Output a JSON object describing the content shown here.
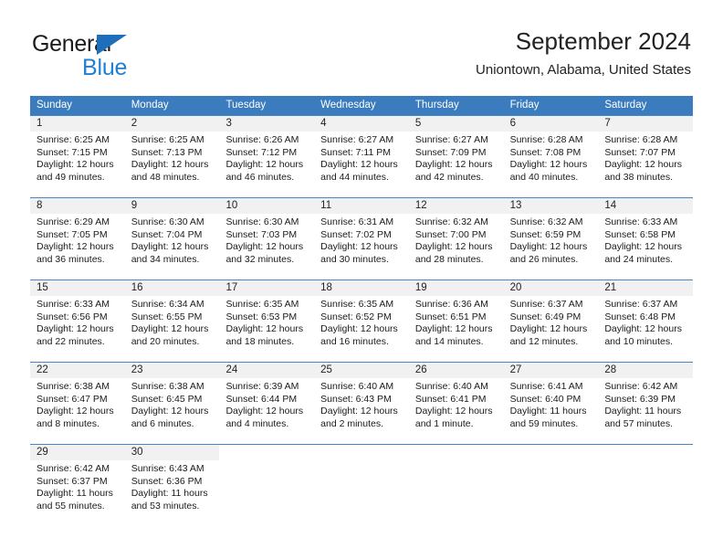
{
  "brand": {
    "word1": "General",
    "word2": "Blue",
    "triangle_color": "#1e6fba",
    "word2_color": "#1e7fd4"
  },
  "header": {
    "title": "September 2024",
    "subtitle": "Uniontown, Alabama, United States"
  },
  "calendar": {
    "header_bg": "#3a7cbe",
    "daynum_bg": "#f1f1f1",
    "weekdays": [
      "Sunday",
      "Monday",
      "Tuesday",
      "Wednesday",
      "Thursday",
      "Friday",
      "Saturday"
    ],
    "weeks": [
      [
        {
          "day": "1",
          "l1": "Sunrise: 6:25 AM",
          "l2": "Sunset: 7:15 PM",
          "l3": "Daylight: 12 hours",
          "l4": "and 49 minutes."
        },
        {
          "day": "2",
          "l1": "Sunrise: 6:25 AM",
          "l2": "Sunset: 7:13 PM",
          "l3": "Daylight: 12 hours",
          "l4": "and 48 minutes."
        },
        {
          "day": "3",
          "l1": "Sunrise: 6:26 AM",
          "l2": "Sunset: 7:12 PM",
          "l3": "Daylight: 12 hours",
          "l4": "and 46 minutes."
        },
        {
          "day": "4",
          "l1": "Sunrise: 6:27 AM",
          "l2": "Sunset: 7:11 PM",
          "l3": "Daylight: 12 hours",
          "l4": "and 44 minutes."
        },
        {
          "day": "5",
          "l1": "Sunrise: 6:27 AM",
          "l2": "Sunset: 7:09 PM",
          "l3": "Daylight: 12 hours",
          "l4": "and 42 minutes."
        },
        {
          "day": "6",
          "l1": "Sunrise: 6:28 AM",
          "l2": "Sunset: 7:08 PM",
          "l3": "Daylight: 12 hours",
          "l4": "and 40 minutes."
        },
        {
          "day": "7",
          "l1": "Sunrise: 6:28 AM",
          "l2": "Sunset: 7:07 PM",
          "l3": "Daylight: 12 hours",
          "l4": "and 38 minutes."
        }
      ],
      [
        {
          "day": "8",
          "l1": "Sunrise: 6:29 AM",
          "l2": "Sunset: 7:05 PM",
          "l3": "Daylight: 12 hours",
          "l4": "and 36 minutes."
        },
        {
          "day": "9",
          "l1": "Sunrise: 6:30 AM",
          "l2": "Sunset: 7:04 PM",
          "l3": "Daylight: 12 hours",
          "l4": "and 34 minutes."
        },
        {
          "day": "10",
          "l1": "Sunrise: 6:30 AM",
          "l2": "Sunset: 7:03 PM",
          "l3": "Daylight: 12 hours",
          "l4": "and 32 minutes."
        },
        {
          "day": "11",
          "l1": "Sunrise: 6:31 AM",
          "l2": "Sunset: 7:02 PM",
          "l3": "Daylight: 12 hours",
          "l4": "and 30 minutes."
        },
        {
          "day": "12",
          "l1": "Sunrise: 6:32 AM",
          "l2": "Sunset: 7:00 PM",
          "l3": "Daylight: 12 hours",
          "l4": "and 28 minutes."
        },
        {
          "day": "13",
          "l1": "Sunrise: 6:32 AM",
          "l2": "Sunset: 6:59 PM",
          "l3": "Daylight: 12 hours",
          "l4": "and 26 minutes."
        },
        {
          "day": "14",
          "l1": "Sunrise: 6:33 AM",
          "l2": "Sunset: 6:58 PM",
          "l3": "Daylight: 12 hours",
          "l4": "and 24 minutes."
        }
      ],
      [
        {
          "day": "15",
          "l1": "Sunrise: 6:33 AM",
          "l2": "Sunset: 6:56 PM",
          "l3": "Daylight: 12 hours",
          "l4": "and 22 minutes."
        },
        {
          "day": "16",
          "l1": "Sunrise: 6:34 AM",
          "l2": "Sunset: 6:55 PM",
          "l3": "Daylight: 12 hours",
          "l4": "and 20 minutes."
        },
        {
          "day": "17",
          "l1": "Sunrise: 6:35 AM",
          "l2": "Sunset: 6:53 PM",
          "l3": "Daylight: 12 hours",
          "l4": "and 18 minutes."
        },
        {
          "day": "18",
          "l1": "Sunrise: 6:35 AM",
          "l2": "Sunset: 6:52 PM",
          "l3": "Daylight: 12 hours",
          "l4": "and 16 minutes."
        },
        {
          "day": "19",
          "l1": "Sunrise: 6:36 AM",
          "l2": "Sunset: 6:51 PM",
          "l3": "Daylight: 12 hours",
          "l4": "and 14 minutes."
        },
        {
          "day": "20",
          "l1": "Sunrise: 6:37 AM",
          "l2": "Sunset: 6:49 PM",
          "l3": "Daylight: 12 hours",
          "l4": "and 12 minutes."
        },
        {
          "day": "21",
          "l1": "Sunrise: 6:37 AM",
          "l2": "Sunset: 6:48 PM",
          "l3": "Daylight: 12 hours",
          "l4": "and 10 minutes."
        }
      ],
      [
        {
          "day": "22",
          "l1": "Sunrise: 6:38 AM",
          "l2": "Sunset: 6:47 PM",
          "l3": "Daylight: 12 hours",
          "l4": "and 8 minutes."
        },
        {
          "day": "23",
          "l1": "Sunrise: 6:38 AM",
          "l2": "Sunset: 6:45 PM",
          "l3": "Daylight: 12 hours",
          "l4": "and 6 minutes."
        },
        {
          "day": "24",
          "l1": "Sunrise: 6:39 AM",
          "l2": "Sunset: 6:44 PM",
          "l3": "Daylight: 12 hours",
          "l4": "and 4 minutes."
        },
        {
          "day": "25",
          "l1": "Sunrise: 6:40 AM",
          "l2": "Sunset: 6:43 PM",
          "l3": "Daylight: 12 hours",
          "l4": "and 2 minutes."
        },
        {
          "day": "26",
          "l1": "Sunrise: 6:40 AM",
          "l2": "Sunset: 6:41 PM",
          "l3": "Daylight: 12 hours",
          "l4": "and 1 minute."
        },
        {
          "day": "27",
          "l1": "Sunrise: 6:41 AM",
          "l2": "Sunset: 6:40 PM",
          "l3": "Daylight: 11 hours",
          "l4": "and 59 minutes."
        },
        {
          "day": "28",
          "l1": "Sunrise: 6:42 AM",
          "l2": "Sunset: 6:39 PM",
          "l3": "Daylight: 11 hours",
          "l4": "and 57 minutes."
        }
      ],
      [
        {
          "day": "29",
          "l1": "Sunrise: 6:42 AM",
          "l2": "Sunset: 6:37 PM",
          "l3": "Daylight: 11 hours",
          "l4": "and 55 minutes."
        },
        {
          "day": "30",
          "l1": "Sunrise: 6:43 AM",
          "l2": "Sunset: 6:36 PM",
          "l3": "Daylight: 11 hours",
          "l4": "and 53 minutes."
        },
        {
          "day": "",
          "l1": "",
          "l2": "",
          "l3": "",
          "l4": ""
        },
        {
          "day": "",
          "l1": "",
          "l2": "",
          "l3": "",
          "l4": ""
        },
        {
          "day": "",
          "l1": "",
          "l2": "",
          "l3": "",
          "l4": ""
        },
        {
          "day": "",
          "l1": "",
          "l2": "",
          "l3": "",
          "l4": ""
        },
        {
          "day": "",
          "l1": "",
          "l2": "",
          "l3": "",
          "l4": ""
        }
      ]
    ]
  }
}
